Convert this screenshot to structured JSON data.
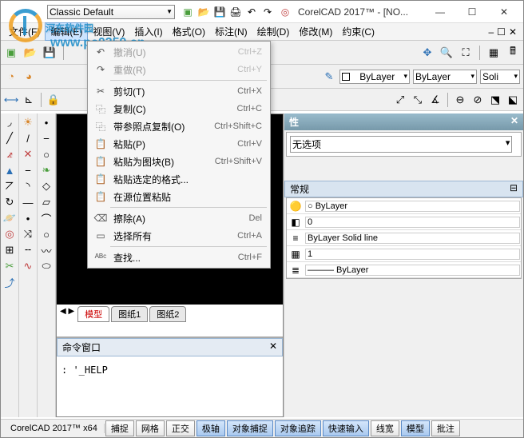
{
  "watermark": {
    "text": "河东软件园",
    "sub": "www.pc0359.cn"
  },
  "title": {
    "theme": "Classic Default",
    "app": "CorelCAD 2017™ - [NO...",
    "min": "—",
    "max": "☐",
    "close": "✕"
  },
  "menubar": {
    "items": [
      "文件(F)",
      "编辑(E)",
      "视图(V)",
      "插入(I)",
      "格式(O)",
      "标注(N)",
      "绘制(D)",
      "修改(M)",
      "约束(C)"
    ],
    "right_icons": [
      "–",
      "☐",
      "✕"
    ]
  },
  "toolbar1": {
    "combo_color": "ByLayer",
    "combo_lt": "ByLayer",
    "combo_lw": "Soli"
  },
  "toolbar2": {
    "layer": "0"
  },
  "dropdown": {
    "items": [
      {
        "icon": "↶",
        "label": "撤消(U)",
        "short": "Ctrl+Z",
        "disabled": true
      },
      {
        "icon": "↷",
        "label": "重做(R)",
        "short": "Ctrl+Y",
        "disabled": true
      },
      {
        "sep": true
      },
      {
        "icon": "✂",
        "label": "剪切(T)",
        "short": "Ctrl+X"
      },
      {
        "icon": "⿻",
        "label": "复制(C)",
        "short": "Ctrl+C"
      },
      {
        "icon": "⿻",
        "label": "带参照点复制(O)",
        "short": "Ctrl+Shift+C"
      },
      {
        "icon": "📋",
        "label": "粘贴(P)",
        "short": "Ctrl+V"
      },
      {
        "icon": "📋",
        "label": "粘贴为图块(B)",
        "short": "Ctrl+Shift+V"
      },
      {
        "icon": "📋",
        "label": "粘贴选定的格式...",
        "short": ""
      },
      {
        "icon": "📋",
        "label": "在源位置粘贴",
        "short": ""
      },
      {
        "sep": true
      },
      {
        "icon": "⌫",
        "label": "擦除(A)",
        "short": "Del"
      },
      {
        "icon": "▭",
        "label": "选择所有",
        "short": "Ctrl+A"
      },
      {
        "sep": true
      },
      {
        "icon": "ᴬᴮᶜ",
        "label": "查找...",
        "short": "Ctrl+F"
      }
    ]
  },
  "right_panel": {
    "header": "性",
    "pin": "✕",
    "select": "无选项",
    "section": "常规",
    "rows": [
      {
        "icon": "🟡",
        "val": "○ ByLayer"
      },
      {
        "icon": "◧",
        "val": "0"
      },
      {
        "icon": "≡",
        "val": "ByLayer    Solid line"
      },
      {
        "icon": "▦",
        "val": "1"
      },
      {
        "icon": "≣",
        "val": "——— ByLayer"
      }
    ]
  },
  "model_tabs": {
    "arrows": "◀ ▶",
    "tabs": [
      "模型",
      "图纸1",
      "图纸2"
    ]
  },
  "cmd": {
    "header": "命令窗口",
    "close": "✕",
    "text": ": '_HELP"
  },
  "status": {
    "app": "CorelCAD 2017™ x64",
    "btns": [
      {
        "t": "捕捉",
        "a": false
      },
      {
        "t": "网格",
        "a": false
      },
      {
        "t": "正交",
        "a": false
      },
      {
        "t": "极轴",
        "a": true
      },
      {
        "t": "对象捕捉",
        "a": true
      },
      {
        "t": "对象追踪",
        "a": true
      },
      {
        "t": "快速输入",
        "a": true
      },
      {
        "t": "线宽",
        "a": false
      },
      {
        "t": "模型",
        "a": true
      },
      {
        "t": "批注",
        "a": false
      }
    ]
  }
}
